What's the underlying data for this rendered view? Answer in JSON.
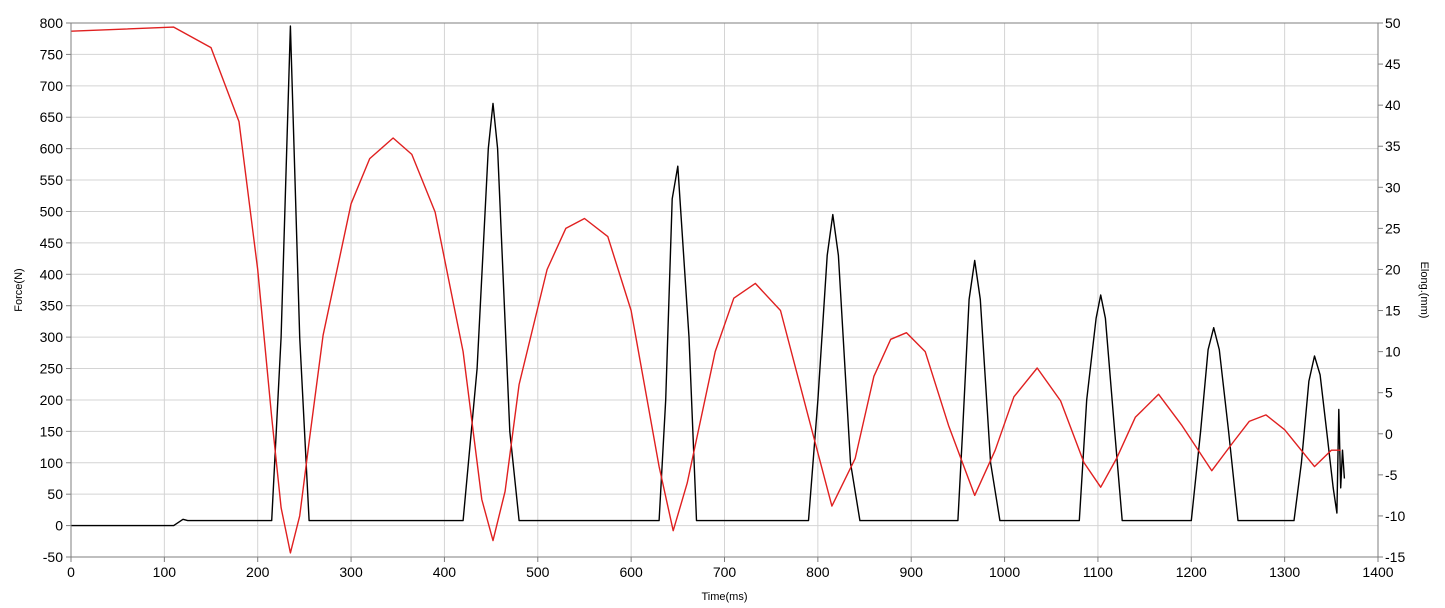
{
  "chart_data": {
    "type": "line",
    "title": "",
    "xlabel": "Time(ms)",
    "ylabel": "Force(N)",
    "y2label": "Elong.(mm)",
    "xlim": [
      0,
      1400
    ],
    "ylim": [
      -50,
      800
    ],
    "y2lim": [
      -15,
      50
    ],
    "grid": true,
    "legend": "none",
    "x_ticks": [
      0,
      100,
      200,
      300,
      400,
      500,
      600,
      700,
      800,
      900,
      1000,
      1100,
      1200,
      1300,
      1400
    ],
    "y_ticks": [
      -50,
      0,
      50,
      100,
      150,
      200,
      250,
      300,
      350,
      400,
      450,
      500,
      550,
      600,
      650,
      700,
      750,
      800
    ],
    "y2_ticks": [
      -15,
      -10,
      -5,
      0,
      5,
      10,
      15,
      20,
      25,
      30,
      35,
      40,
      45,
      50
    ],
    "series": [
      {
        "axis": "left",
        "color": "#000000",
        "x": [
          0,
          110,
          120,
          125,
          215,
          225,
          235,
          245,
          255,
          310,
          420,
          435,
          447,
          452,
          457,
          470,
          480,
          520,
          630,
          637,
          644,
          650,
          662,
          670,
          790,
          800,
          810,
          816,
          822,
          835,
          845,
          900,
          950,
          955,
          962,
          968,
          974,
          985,
          995,
          1050,
          1080,
          1088,
          1098,
          1103,
          1108,
          1118,
          1126,
          1190,
          1200,
          1210,
          1218,
          1224,
          1230,
          1240,
          1250,
          1310,
          1318,
          1326,
          1332,
          1338,
          1345,
          1352,
          1356,
          1358,
          1360,
          1362,
          1364
        ],
        "values": [
          0,
          0,
          10,
          8,
          8,
          300,
          795,
          300,
          8,
          8,
          8,
          250,
          600,
          672,
          600,
          150,
          8,
          8,
          8,
          200,
          520,
          572,
          300,
          8,
          8,
          200,
          430,
          495,
          430,
          100,
          8,
          8,
          8,
          150,
          360,
          422,
          360,
          100,
          8,
          8,
          8,
          200,
          330,
          367,
          330,
          150,
          8,
          8,
          8,
          150,
          280,
          315,
          280,
          150,
          8,
          8,
          100,
          230,
          270,
          240,
          150,
          60,
          20,
          185,
          60,
          120,
          75
        ]
      },
      {
        "axis": "right",
        "color": "#e02020",
        "x": [
          0,
          110,
          150,
          180,
          200,
          215,
          225,
          235,
          245,
          255,
          270,
          300,
          320,
          345,
          365,
          390,
          420,
          440,
          452,
          465,
          480,
          510,
          530,
          550,
          575,
          600,
          630,
          645,
          660,
          690,
          710,
          733,
          760,
          790,
          815,
          840,
          860,
          878,
          895,
          915,
          940,
          968,
          990,
          1010,
          1035,
          1060,
          1085,
          1103,
          1120,
          1140,
          1165,
          1190,
          1222,
          1245,
          1262,
          1280,
          1300,
          1332,
          1350,
          1360
        ],
        "values": [
          49,
          49.5,
          47,
          38,
          20,
          2,
          -9,
          -14.5,
          -10,
          -1,
          12,
          28,
          33.5,
          36,
          34,
          27,
          10,
          -8,
          -13,
          -7,
          6,
          20,
          25,
          26.2,
          24,
          15,
          -4,
          -11.8,
          -6,
          10,
          16.5,
          18.3,
          15,
          2,
          -8.8,
          -3,
          7,
          11.5,
          12.3,
          10,
          1,
          -7.5,
          -2,
          4.5,
          8,
          4,
          -3.5,
          -6.5,
          -3,
          2,
          4.8,
          1,
          -4.5,
          -1,
          1.5,
          2.3,
          0.5,
          -4,
          -2,
          -2
        ]
      }
    ]
  }
}
